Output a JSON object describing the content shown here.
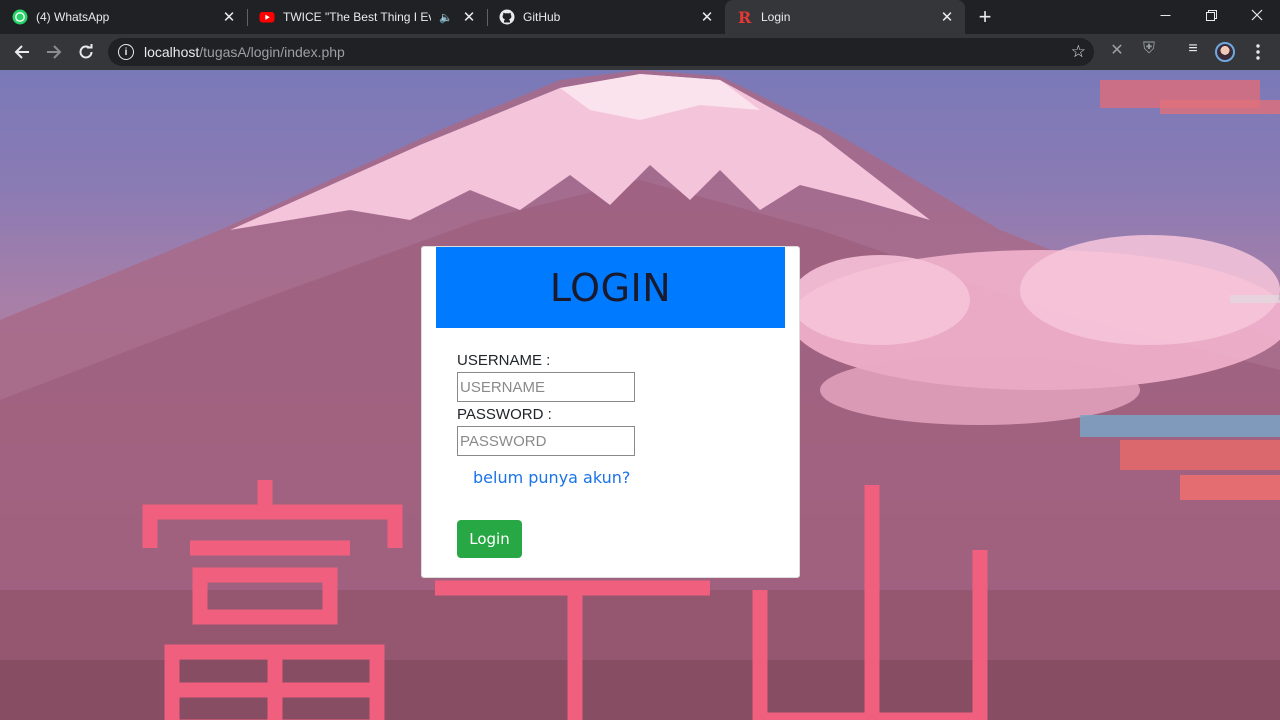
{
  "browser": {
    "tabs": [
      {
        "title": "(4) WhatsApp",
        "icon": "whatsapp-icon",
        "active": false
      },
      {
        "title": "TWICE \"The Best Thing I Ever",
        "icon": "youtube-icon",
        "active": false,
        "audio": true
      },
      {
        "title": "GitHub",
        "icon": "github-icon",
        "active": false
      },
      {
        "title": "Login",
        "icon": "r-logo-icon",
        "active": true
      }
    ],
    "url_host": "localhost",
    "url_path": "/tugasA/login/index.php",
    "new_tab_glyph": "+",
    "close_glyph": "✕",
    "audio_glyph": "🔈"
  },
  "login": {
    "title": "LOGIN",
    "username_label": "USERNAME :",
    "username_placeholder": "USERNAME",
    "password_label": "PASSWORD :",
    "password_placeholder": "PASSWORD",
    "register_link": "belum punya akun?",
    "submit_label": "Login"
  },
  "background": {
    "kanji": "富士山",
    "colors": {
      "sky": "#7a79b8",
      "snow": "#f4c4da",
      "kanji": "#f0607e",
      "header": "#007bff",
      "button": "#28a745",
      "link": "#1a73e8"
    }
  }
}
